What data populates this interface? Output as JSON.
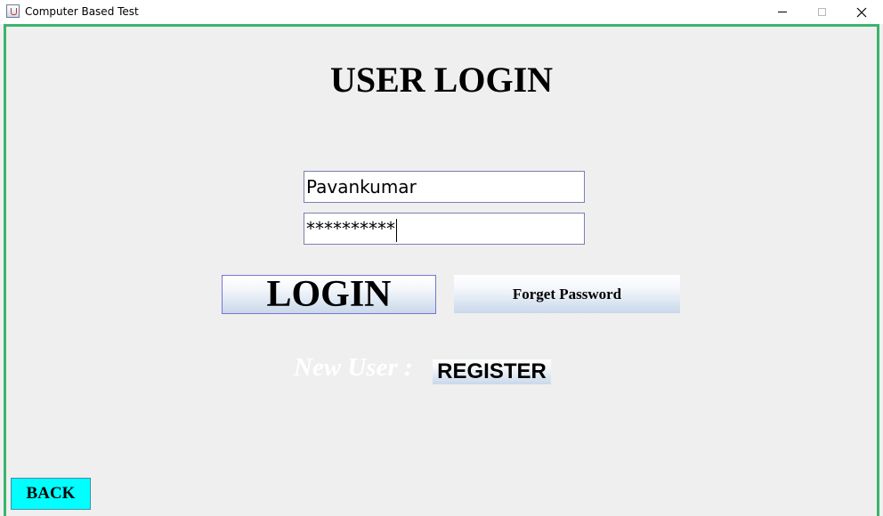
{
  "window": {
    "title": "Computer Based Test",
    "controls": [
      "minimize-icon",
      "maximize-icon",
      "close-icon"
    ]
  },
  "form": {
    "heading": "USER LOGIN",
    "username_value": "Pavankumar",
    "password_value": "**********"
  },
  "buttons": {
    "login": "LOGIN",
    "forget_password": "Forget Password",
    "register": "REGISTER",
    "back": "BACK"
  },
  "labels": {
    "new_user": "New User :"
  },
  "colors": {
    "frame_border": "#3cb46e",
    "back_button": "#00ffff",
    "login_border": "#7a74d4"
  }
}
